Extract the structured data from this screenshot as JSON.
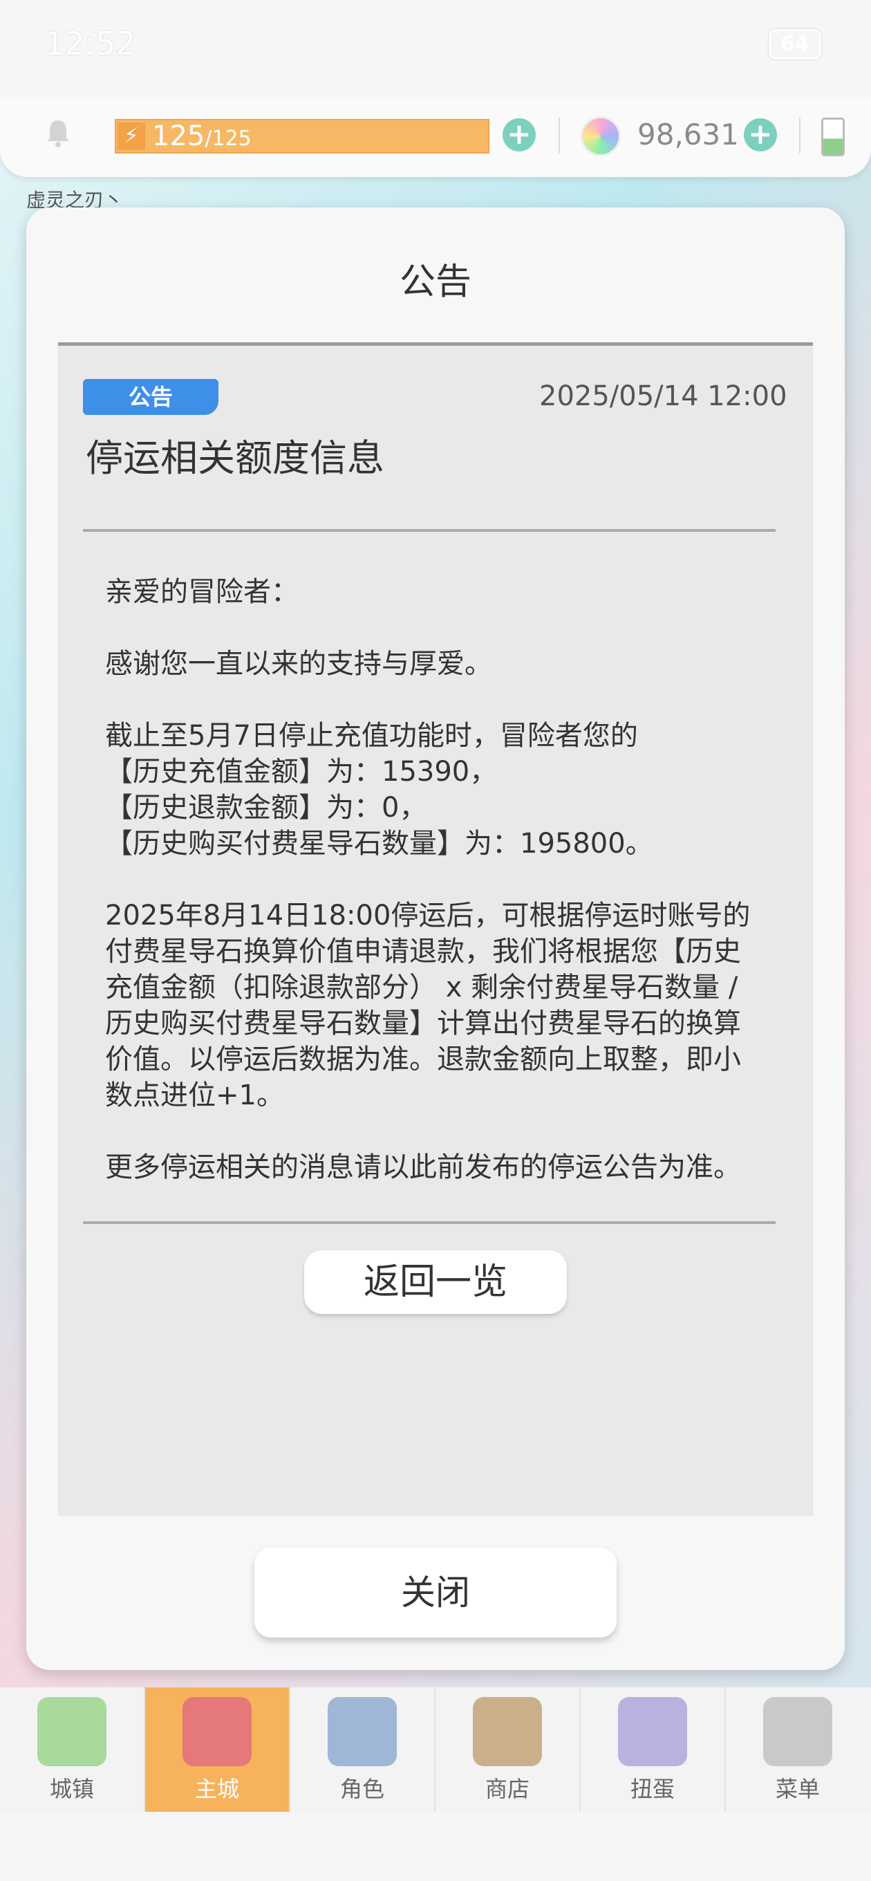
{
  "status": {
    "time": "12:52",
    "battery": "64"
  },
  "resources": {
    "stamina_current": "125",
    "stamina_max": "/125",
    "gems": "98,631",
    "bolt_icon": "⚡",
    "plus_icon": "+"
  },
  "skill_label": "虚灵之刃丶",
  "modal": {
    "title": "公告",
    "tag": "公告",
    "date": "2025/05/14 12:00",
    "headline": "停运相关额度信息",
    "body": {
      "greeting": "亲爱的冒险者：",
      "thanks": "感谢您一直以来的支持与厚爱。",
      "p1_line1": "截止至5月7日停止充值功能时，冒险者您的",
      "p1_line2": "【历史充值金额】为：15390，",
      "p1_line3": "【历史退款金额】为：0，",
      "p1_line4": "【历史购买付费星导石数量】为：195800。",
      "p2": "2025年8月14日18:00停运后，可根据停运时账号的付费星导石换算价值申请退款，我们将根据您【历史充值金额（扣除退款部分） x 剩余付费星导石数量 / 历史购买付费星导石数量】计算出付费星导石的换算价值。以停运后数据为准。退款金额向上取整，即小数点进位+1。",
      "p3": "更多停运相关的消息请以此前发布的停运公告为准。"
    },
    "back_button": "返回一览",
    "close_button": "关闭"
  },
  "nav": {
    "items": [
      {
        "label": "城镇",
        "icon": "town-icon",
        "color": "#a9d99b"
      },
      {
        "label": "主城",
        "icon": "main-city-icon",
        "color": "#e5787b",
        "active": true
      },
      {
        "label": "角色",
        "icon": "character-icon",
        "color": "#9fb6d6"
      },
      {
        "label": "商店",
        "icon": "shop-icon",
        "color": "#c9b08a"
      },
      {
        "label": "扭蛋",
        "icon": "gacha-icon",
        "color": "#b9b2de"
      },
      {
        "label": "菜单",
        "icon": "menu-icon",
        "color": "#c9c9c9"
      }
    ]
  }
}
